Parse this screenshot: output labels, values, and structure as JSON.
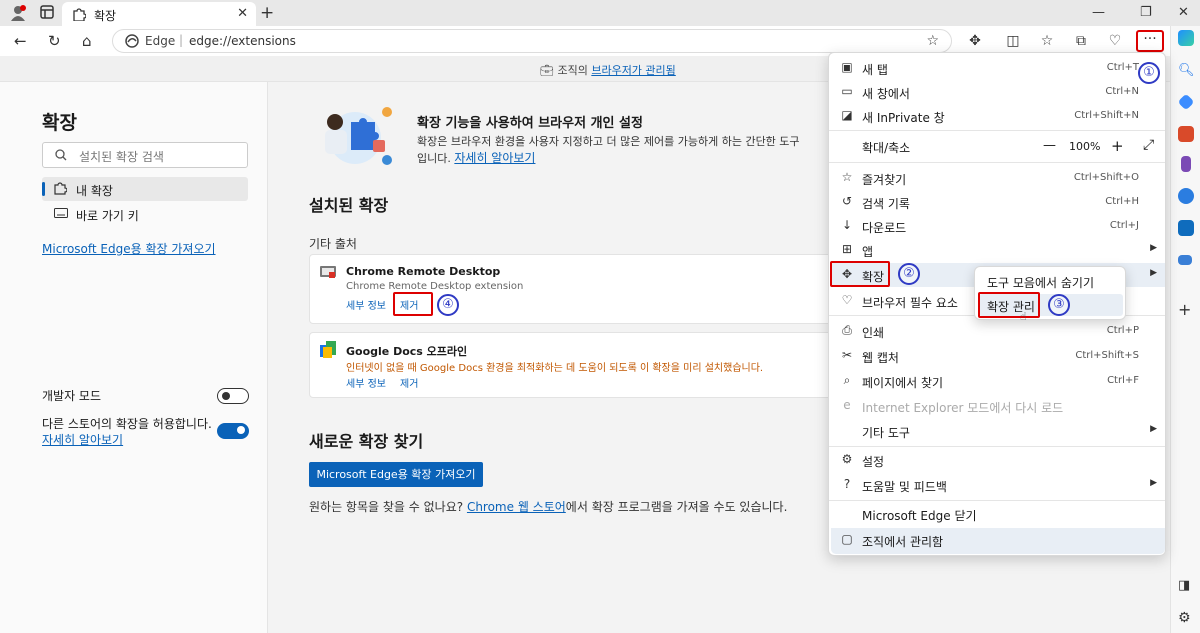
{
  "browser": {
    "tab_title": "확장",
    "address_site": "Edge",
    "address_url": "edge://extensions"
  },
  "banner": {
    "prefix": "조직의 ",
    "link": "브라우저가 관리됨"
  },
  "left_panel": {
    "title": "확장",
    "search_placeholder": "설치된 확장 검색",
    "nav_items": [
      {
        "label": "내 확장",
        "icon": "puzzle-icon",
        "selected": true
      },
      {
        "label": "바로 가기 키",
        "icon": "keyboard-icon",
        "selected": false
      }
    ],
    "get_link": "Microsoft Edge용 확장 가져오기",
    "dev_mode_label": "개발자 모드",
    "dev_mode_on": false,
    "allow_other_label": "다른 스토어의 확장을 허용합니다.",
    "allow_other_link": "자세히 알아보기",
    "allow_other_on": true
  },
  "main": {
    "hero_title": "확장 기능을 사용하여 브라우저 개인 설정",
    "hero_desc": "확장은 브라우저 환경을 사용자 지정하고 더 많은 제어를 가능하게 하는 간단한 도구",
    "hero_desc2": "입니다.",
    "hero_link": "자세히 알아보기",
    "installed_title": "설치된 확장",
    "other_sources": "기타 출처",
    "extensions": [
      {
        "name": "Chrome Remote Desktop",
        "desc": "Chrome Remote Desktop extension",
        "details": "세부 정보",
        "remove": "제거"
      },
      {
        "name": "Google Docs 오프라인",
        "desc": "인터넷이 없을 때 Google Docs 환경을 최적화하는 데 도움이 되도록 이 확장을 미리 설치했습니다.",
        "details": "세부 정보",
        "remove": "제거"
      }
    ],
    "find_title": "새로운 확장 찾기",
    "get_button": "Microsoft Edge용 확장 가져오기",
    "footer_prefix": "원하는 항목을 찾을 수 없나요? ",
    "footer_link": "Chrome 웹 스토어",
    "footer_suffix": "에서 확장 프로그램을 가져올 수도 있습니다."
  },
  "menu": {
    "items": [
      {
        "label": "새 탭",
        "shortcut": "Ctrl+T",
        "icon": "new-tab-icon"
      },
      {
        "label": "새 창에서",
        "shortcut": "Ctrl+N",
        "icon": "new-window-icon"
      },
      {
        "label": "새 InPrivate 창",
        "shortcut": "Ctrl+Shift+N",
        "icon": "inprivate-icon"
      },
      {
        "label": "확대/축소",
        "zoom": "100%",
        "icon": ""
      },
      {
        "label": "즐겨찾기",
        "shortcut": "Ctrl+Shift+O",
        "icon": "favorites-icon"
      },
      {
        "label": "검색 기록",
        "shortcut": "Ctrl+H",
        "icon": "history-icon"
      },
      {
        "label": "다운로드",
        "shortcut": "Ctrl+J",
        "icon": "download-icon"
      },
      {
        "label": "앱",
        "shortcut": "",
        "icon": "apps-icon"
      },
      {
        "label": "확장",
        "shortcut": "",
        "icon": "puzzle-icon"
      },
      {
        "label": "브라우저 필수 요소",
        "shortcut": "",
        "icon": "heart-pulse-icon"
      },
      {
        "label": "인쇄",
        "shortcut": "Ctrl+P",
        "icon": "print-icon"
      },
      {
        "label": "웹 캡처",
        "shortcut": "Ctrl+Shift+S",
        "icon": "web-capture-icon"
      },
      {
        "label": "페이지에서 찾기",
        "shortcut": "Ctrl+F",
        "icon": "find-icon"
      },
      {
        "label": "Internet Explorer 모드에서 다시 로드",
        "shortcut": "",
        "icon": "ie-icon"
      },
      {
        "label": "기타 도구",
        "shortcut": "",
        "icon": ""
      },
      {
        "label": "설정",
        "shortcut": "",
        "icon": "gear-icon"
      },
      {
        "label": "도움말 및 피드백",
        "shortcut": "",
        "icon": "help-icon"
      },
      {
        "label": "Microsoft Edge 닫기",
        "shortcut": "",
        "icon": ""
      },
      {
        "label": "조직에서 관리함",
        "shortcut": "",
        "icon": "briefcase-icon"
      }
    ],
    "zoom_minus": "—",
    "zoom_plus": "+"
  },
  "submenu": {
    "items": [
      "도구 모음에서 숨기기",
      "확장 관리"
    ]
  },
  "annotations": [
    "①",
    "②",
    "③",
    "④"
  ],
  "colors": {
    "accent": "#0a62b8",
    "annotation_red": "#dd0000",
    "annotation_blue": "#2f3ac4",
    "warning": "#c15700"
  }
}
